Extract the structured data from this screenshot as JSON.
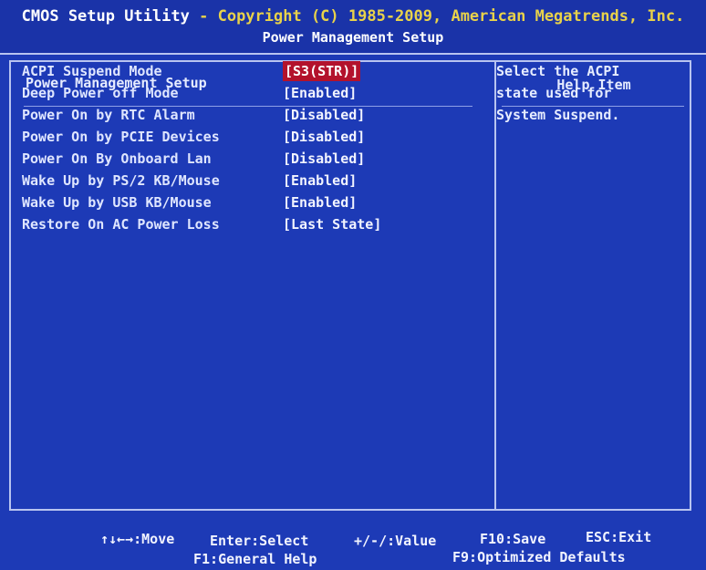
{
  "title": {
    "utility": "CMOS Setup Utility",
    "separator": " - ",
    "copyright": "Copyright (C) 1985-2009, American Megatrends, Inc.",
    "subtitle": "Power Management Setup"
  },
  "left_panel": {
    "heading": "Power Management Setup",
    "items": [
      {
        "label": "ACPI Suspend Mode",
        "value": "[S3(STR)]",
        "selected": true
      },
      {
        "label": "Deep Power off Mode",
        "value": "[Enabled]"
      },
      {
        "label": "Power On by RTC Alarm",
        "value": "[Disabled]"
      },
      {
        "label": "Power On by PCIE Devices",
        "value": "[Disabled]"
      },
      {
        "label": "Power On By Onboard Lan",
        "value": "[Disabled]"
      },
      {
        "label": "Wake Up by PS/2 KB/Mouse",
        "value": "[Enabled]"
      },
      {
        "label": "Wake Up by USB KB/Mouse",
        "value": "[Enabled]"
      },
      {
        "label": "Restore On AC Power Loss",
        "value": "[Last State]"
      }
    ]
  },
  "right_panel": {
    "heading": "Help Item",
    "help_lines": [
      "Select the ACPI",
      "state used for",
      "System Suspend."
    ]
  },
  "footer": {
    "move": "↑↓←→:Move",
    "enter": "Enter:Select",
    "value": "+/-/:Value",
    "save": "F10:Save",
    "exit": "ESC:Exit",
    "help": "F1:General Help",
    "defaults": "F9:Optimized Defaults"
  },
  "colors": {
    "background": "#1d3ab6",
    "selection": "#b3122c",
    "title_accent": "#e8d24a"
  }
}
